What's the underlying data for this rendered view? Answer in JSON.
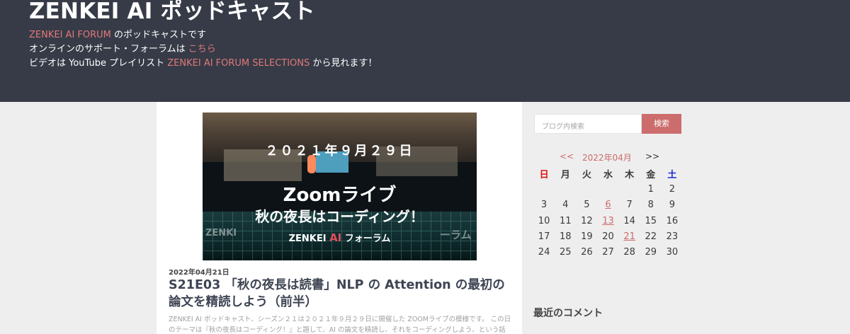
{
  "header": {
    "title": "ZENKEI AI ポッドキャスト",
    "line1_link": "ZENKEI AI FORUM",
    "line1_text": " のポッドキャストです",
    "line2_text": "オンラインのサポート・フォーラムは ",
    "line2_link": "こちら",
    "line3_text1": "ビデオは YouTube プレイリスト ",
    "line3_link": "ZENKEI AI FORUM SELECTIONS",
    "line3_text2": " から見れます！"
  },
  "post": {
    "hero": {
      "date": "２０２１年９月２９日",
      "title1": "Zoomライブ",
      "title2": "秋の夜長はコーディング！",
      "brand_prefix": "ZENKEI ",
      "brand_ai": "AI",
      "brand_suffix": " フォーラム",
      "side_left": "ZENKI",
      "side_right": "ーラム"
    },
    "date": "2022年04月21日",
    "title": "S21E03 「秋の夜長は読書」NLP の Attention の最初の論文を精読しよう（前半）",
    "excerpt": "ZENKEI AI ポッドキャスト、シーズン２１は２０２１年９月２９日に開催した ZOOMライブの模様です。 この日のテーマは『秋の夜長はコーディング！』と題して、AI の論文を精読し、それをコーディングしよう、という話"
  },
  "sidebar": {
    "search_placeholder": "ブログ内検索",
    "search_button": "検索",
    "calendar": {
      "prev": "<<",
      "month": "2022年04月",
      "next": ">>",
      "weekdays": [
        "日",
        "月",
        "火",
        "水",
        "木",
        "金",
        "土"
      ],
      "weeks": [
        [
          "",
          "",
          "",
          "",
          "",
          "1",
          "2"
        ],
        [
          "3",
          "4",
          "5",
          "6",
          "7",
          "8",
          "9"
        ],
        [
          "10",
          "11",
          "12",
          "13",
          "14",
          "15",
          "16"
        ],
        [
          "17",
          "18",
          "19",
          "20",
          "21",
          "22",
          "23"
        ],
        [
          "24",
          "25",
          "26",
          "27",
          "28",
          "29",
          "30"
        ]
      ],
      "linked_days": [
        "6",
        "13",
        "21"
      ]
    },
    "recent_comments_title": "最近のコメント"
  },
  "colors": {
    "header_bg": "#363b47",
    "accent": "#cc6c6c",
    "page_bg": "#eeeeee"
  }
}
